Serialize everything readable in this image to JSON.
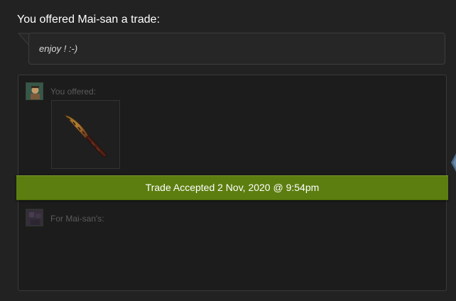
{
  "message": {
    "heading": "You offered Mai-san a trade:",
    "note": "enjoy ! :-)"
  },
  "trade": {
    "you_label": "You offered:",
    "them_label": "For Mai-san's:",
    "status_text": "Trade Accepted 2 Nov, 2020 @ 9:54pm",
    "item_icon": "knife-item-icon",
    "colors": {
      "accepted": "#5c7e10",
      "background": "#1c1c1c"
    }
  }
}
